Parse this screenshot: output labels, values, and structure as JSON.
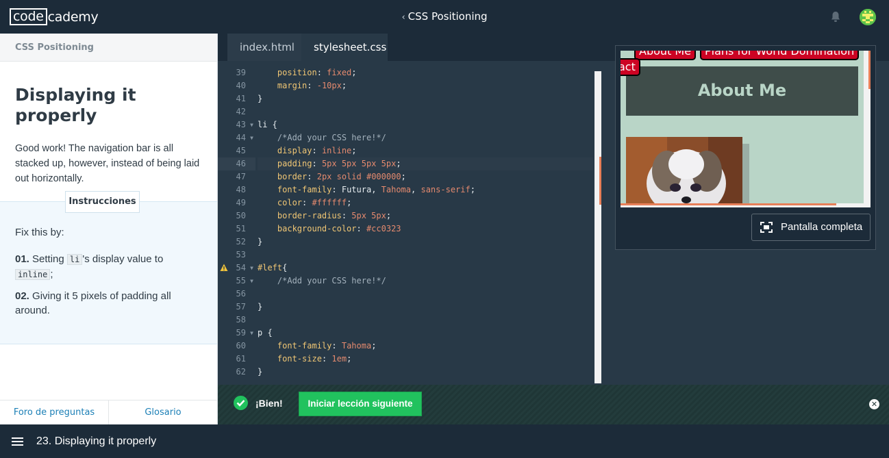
{
  "topbar": {
    "logo_left": "code",
    "logo_right": "cademy",
    "breadcrumb_chevron": "‹",
    "breadcrumb": "CSS Positioning",
    "bell_icon": "bell-icon",
    "avatar_icon": "avatar-icon"
  },
  "left_panel": {
    "header": "CSS Positioning",
    "title": "Displaying it properly",
    "text": "Good work! The navigation bar is all stacked up, however, instead of being laid out horizontally.",
    "instructions_tab": "Instrucciones",
    "fix_intro": "Fix this by:",
    "steps": [
      {
        "num": "01.",
        "pre": "Setting ",
        "code": "li",
        "mid": "'s display value to",
        "code2": "inline",
        "post": ";"
      },
      {
        "num": "02.",
        "text": "Giving it 5 pixels of padding all around."
      }
    ],
    "footer_forum": "Foro de preguntas",
    "footer_glossary": "Glosario"
  },
  "editor": {
    "tabs": [
      "index.html",
      "stylesheet.css"
    ],
    "active_tab": "stylesheet.css",
    "line_numbers": [
      "39",
      "40",
      "41",
      "42",
      "43",
      "44",
      "45",
      "46",
      "47",
      "48",
      "49",
      "50",
      "51",
      "52",
      "53",
      "54",
      "55",
      "56",
      "57",
      "58",
      "59",
      "60",
      "61",
      "62"
    ]
  },
  "preview": {
    "nav_items": [
      "About Me",
      "Plans for World Domination",
      "act"
    ],
    "about_heading": "About Me",
    "fullscreen_label": "Pantalla completa",
    "fullscreen_icon": "expand-icon"
  },
  "success_bar": {
    "status": "¡Bien!",
    "next_button": "Iniciar lección siguiente",
    "close_icon": "close-icon",
    "check_icon": "check-icon"
  },
  "bottom_bar": {
    "menu_icon": "hamburger-icon",
    "title": "23. Displaying it properly"
  },
  "colors": {
    "brand_dark": "#1c2b39",
    "editor_bg": "#283947",
    "success_green": "#21c25e",
    "nav_red": "#cc0323",
    "link_blue": "#1b7fb6"
  }
}
